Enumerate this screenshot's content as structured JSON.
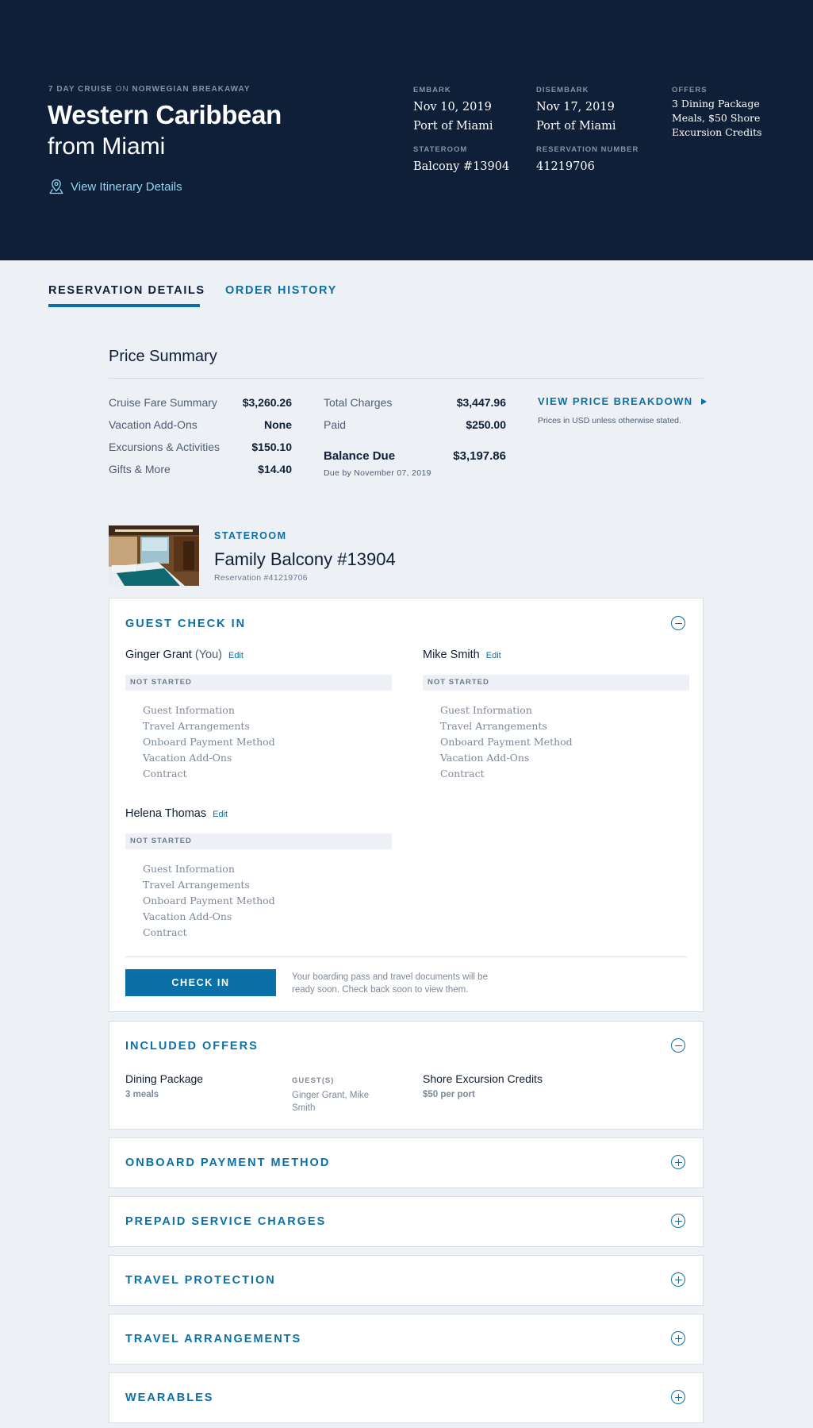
{
  "header": {
    "cruise_length": "7 DAY CRUISE",
    "on_word": "ON",
    "ship": "NORWEGIAN BREAKAWAY",
    "title": "Western Caribbean",
    "subtitle": "from Miami",
    "itinerary_link": "View Itinerary Details",
    "embark_label": "EMBARK",
    "embark_date": "Nov 10, 2019",
    "embark_port": "Port of Miami",
    "disembark_label": "DISEMBARK",
    "disembark_date": "Nov 17, 2019",
    "disembark_port": "Port of Miami",
    "offers_label": "OFFERS",
    "offers_value": "3 Dining Package Meals, $50 Shore Excursion Credits",
    "stateroom_label": "STATEROOM",
    "stateroom_value": "Balcony #13904",
    "reservation_label": "RESERVATION NUMBER",
    "reservation_value": "41219706"
  },
  "tabs": [
    {
      "label": "RESERVATION DETAILS",
      "active": true
    },
    {
      "label": "ORDER HISTORY",
      "active": false
    }
  ],
  "price_summary": {
    "title": "Price Summary",
    "left": [
      {
        "label": "Cruise Fare Summary",
        "value": "$3,260.26"
      },
      {
        "label": "Vacation Add-Ons",
        "value": "None"
      },
      {
        "label": "Excursions & Activities",
        "value": "$150.10"
      },
      {
        "label": "Gifts & More",
        "value": "$14.40"
      }
    ],
    "right": [
      {
        "label": "Total Charges",
        "value": "$3,447.96"
      },
      {
        "label": "Paid",
        "value": "$250.00"
      }
    ],
    "balance_label": "Balance Due",
    "balance_value": "$3,197.86",
    "due_by": "Due by November 07, 2019",
    "breakdown_link": "VIEW PRICE BREAKDOWN",
    "currency_note": "Prices in USD unless otherwise stated."
  },
  "stateroom": {
    "label": "STATEROOM",
    "name": "Family Balcony #13904",
    "reservation": "Reservation #41219706"
  },
  "check_in": {
    "title": "GUEST CHECK IN",
    "edit_label": "Edit",
    "you_label": "(You)",
    "guests": [
      {
        "name": "Ginger Grant",
        "status": "NOT STARTED"
      },
      {
        "name": "Mike Smith",
        "status": "NOT STARTED"
      },
      {
        "name": "Helena Thomas",
        "status": "NOT STARTED"
      }
    ],
    "steps": [
      "Guest Information",
      "Travel Arrangements",
      "Onboard Payment Method",
      "Vacation Add-Ons",
      "Contract"
    ],
    "button": "CHECK IN",
    "note": "Your boarding pass and travel documents will be ready soon. Check back soon to view them."
  },
  "included_offers": {
    "title": "INCLUDED OFFERS",
    "dining_name": "Dining Package",
    "dining_sub": "3 meals",
    "guests_label": "GUEST(S)",
    "guests_value": "Ginger Grant, Mike Smith",
    "shore_name": "Shore Excursion Credits",
    "shore_sub": "$50 per port"
  },
  "collapsed_sections": [
    "ONBOARD PAYMENT METHOD",
    "PREPAID SERVICE CHARGES",
    "TRAVEL PROTECTION",
    "TRAVEL ARRANGEMENTS",
    "WEARABLES"
  ],
  "colors": {
    "header_bg": "#0e1f37",
    "accent": "#0b70a6",
    "link_light": "#8fd7f0",
    "page_bg": "#edf0f4"
  }
}
